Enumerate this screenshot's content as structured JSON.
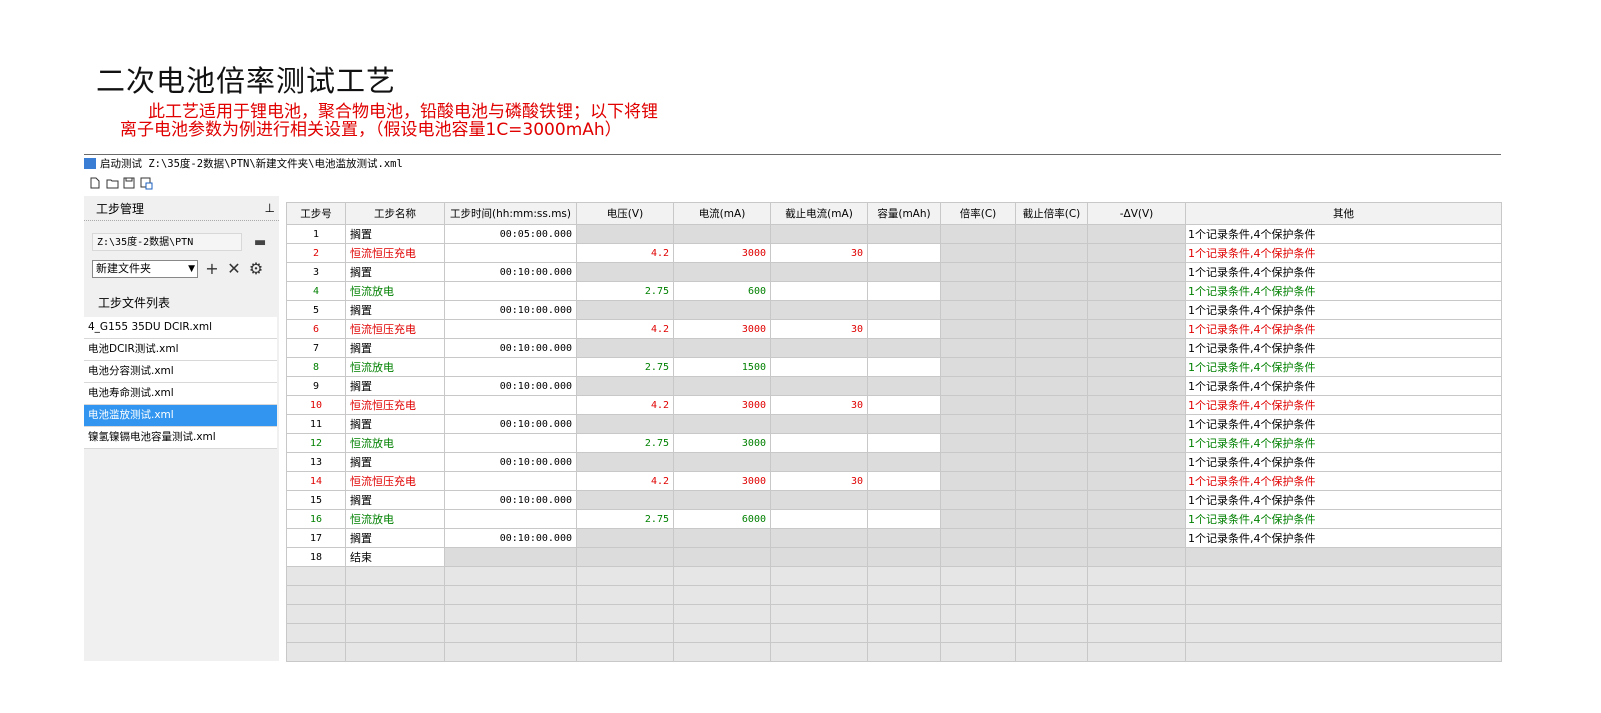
{
  "heading": {
    "title": "二次电池倍率测试工艺",
    "line1": "此工艺适用于锂电池，聚合物电池，铅酸电池与磷酸铁锂；以下将锂",
    "line2": "离子电池参数为例进行相关设置，（假设电池容量1C=3000mAh）"
  },
  "window": {
    "title": "启动测试 Z:\\35度-2数据\\PTN\\新建文件夹\\电池滥放测试.xml"
  },
  "toolbar": {
    "icons": [
      "new-file-icon",
      "open-folder-icon",
      "save-icon",
      "save-as-icon"
    ]
  },
  "sidebar": {
    "panel_title": "工步管理",
    "pin": "ᵖ",
    "path": "Z:\\35度-2数据\\PTN",
    "folder": "新建文件夹",
    "list_label": "工步文件列表",
    "files": [
      {
        "name": "4_G155 35DU DCIR.xml",
        "selected": false
      },
      {
        "name": "电池DCIR测试.xml",
        "selected": false
      },
      {
        "name": "电池分容测试.xml",
        "selected": false
      },
      {
        "name": "电池寿命测试.xml",
        "selected": false
      },
      {
        "name": "电池滥放测试.xml",
        "selected": true
      },
      {
        "name": "镍氢镍镉电池容量测试.xml",
        "selected": false
      }
    ]
  },
  "table": {
    "headers": [
      "工步号",
      "工步名称",
      "工步时间(hh:mm:ss.ms)",
      "电压(V)",
      "电流(mA)",
      "截止电流(mA)",
      "容量(mAh)",
      "倍率(C)",
      "截止倍率(C)",
      "-ΔV(V)",
      "其他"
    ],
    "rows": [
      {
        "no": "1",
        "name": "搁置",
        "time": "00:05:00.000",
        "voltage": "",
        "current": "",
        "cutoff": "",
        "other": "1个记录条件,4个保护条件",
        "color": "black"
      },
      {
        "no": "2",
        "name": "恒流恒压充电",
        "time": "",
        "voltage": "4.2",
        "current": "3000",
        "cutoff": "30",
        "other": "1个记录条件,4个保护条件",
        "color": "red"
      },
      {
        "no": "3",
        "name": "搁置",
        "time": "00:10:00.000",
        "voltage": "",
        "current": "",
        "cutoff": "",
        "other": "1个记录条件,4个保护条件",
        "color": "black"
      },
      {
        "no": "4",
        "name": "恒流放电",
        "time": "",
        "voltage": "2.75",
        "current": "600",
        "cutoff": "",
        "other": "1个记录条件,4个保护条件",
        "color": "green"
      },
      {
        "no": "5",
        "name": "搁置",
        "time": "00:10:00.000",
        "voltage": "",
        "current": "",
        "cutoff": "",
        "other": "1个记录条件,4个保护条件",
        "color": "black"
      },
      {
        "no": "6",
        "name": "恒流恒压充电",
        "time": "",
        "voltage": "4.2",
        "current": "3000",
        "cutoff": "30",
        "other": "1个记录条件,4个保护条件",
        "color": "red"
      },
      {
        "no": "7",
        "name": "搁置",
        "time": "00:10:00.000",
        "voltage": "",
        "current": "",
        "cutoff": "",
        "other": "1个记录条件,4个保护条件",
        "color": "black"
      },
      {
        "no": "8",
        "name": "恒流放电",
        "time": "",
        "voltage": "2.75",
        "current": "1500",
        "cutoff": "",
        "other": "1个记录条件,4个保护条件",
        "color": "green"
      },
      {
        "no": "9",
        "name": "搁置",
        "time": "00:10:00.000",
        "voltage": "",
        "current": "",
        "cutoff": "",
        "other": "1个记录条件,4个保护条件",
        "color": "black"
      },
      {
        "no": "10",
        "name": "恒流恒压充电",
        "time": "",
        "voltage": "4.2",
        "current": "3000",
        "cutoff": "30",
        "other": "1个记录条件,4个保护条件",
        "color": "red"
      },
      {
        "no": "11",
        "name": "搁置",
        "time": "00:10:00.000",
        "voltage": "",
        "current": "",
        "cutoff": "",
        "other": "1个记录条件,4个保护条件",
        "color": "black"
      },
      {
        "no": "12",
        "name": "恒流放电",
        "time": "",
        "voltage": "2.75",
        "current": "3000",
        "cutoff": "",
        "other": "1个记录条件,4个保护条件",
        "color": "green"
      },
      {
        "no": "13",
        "name": "搁置",
        "time": "00:10:00.000",
        "voltage": "",
        "current": "",
        "cutoff": "",
        "other": "1个记录条件,4个保护条件",
        "color": "black"
      },
      {
        "no": "14",
        "name": "恒流恒压充电",
        "time": "",
        "voltage": "4.2",
        "current": "3000",
        "cutoff": "30",
        "other": "1个记录条件,4个保护条件",
        "color": "red"
      },
      {
        "no": "15",
        "name": "搁置",
        "time": "00:10:00.000",
        "voltage": "",
        "current": "",
        "cutoff": "",
        "other": "1个记录条件,4个保护条件",
        "color": "black"
      },
      {
        "no": "16",
        "name": "恒流放电",
        "time": "",
        "voltage": "2.75",
        "current": "6000",
        "cutoff": "",
        "other": "1个记录条件,4个保护条件",
        "color": "green"
      },
      {
        "no": "17",
        "name": "搁置",
        "time": "00:10:00.000",
        "voltage": "",
        "current": "",
        "cutoff": "",
        "other": "1个记录条件,4个保护条件",
        "color": "black"
      },
      {
        "no": "18",
        "name": "结束",
        "time": "",
        "voltage": "",
        "current": "",
        "cutoff": "",
        "other": "",
        "color": "black"
      }
    ],
    "empty_rows": 5
  },
  "colors": {
    "red": "#e00000",
    "green": "#008000",
    "selection": "#3296f0"
  }
}
